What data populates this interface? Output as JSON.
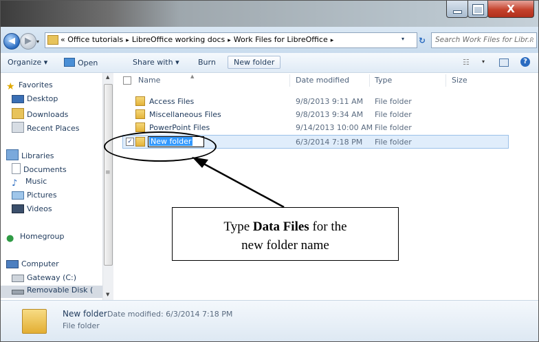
{
  "window": {
    "controls": {
      "minimize": "minimize",
      "maximize": "maximize",
      "close_glyph": "X"
    }
  },
  "address": {
    "history_glyph": "▾",
    "overflow": "«",
    "crumbs": [
      "Office tutorials",
      "LibreOffice working docs",
      "Work Files for LibreOffice"
    ],
    "crumb_sep": "▸",
    "refresh": "↻"
  },
  "search": {
    "placeholder": "Search Work Files for Libr..."
  },
  "toolbar": {
    "organize": "Organize ▾",
    "open": "Open",
    "share_with": "Share with ▾",
    "burn": "Burn",
    "new_folder": "New folder",
    "help": "?"
  },
  "nav": {
    "favorites": "Favorites",
    "desktop": "Desktop",
    "downloads": "Downloads",
    "recent_places": "Recent Places",
    "libraries": "Libraries",
    "documents": "Documents",
    "music": "Music",
    "pictures": "Pictures",
    "videos": "Videos",
    "homegroup": "Homegroup",
    "computer": "Computer",
    "gateway": "Gateway (C:)",
    "removable": "Removable Disk ("
  },
  "columns": {
    "name": "Name",
    "date": "Date modified",
    "type": "Type",
    "size": "Size"
  },
  "files": [
    {
      "name": "Access Files",
      "date": "9/8/2013 9:11 AM",
      "type": "File folder"
    },
    {
      "name": "Miscellaneous Files",
      "date": "9/8/2013 9:34 AM",
      "type": "File folder"
    },
    {
      "name": "PowerPoint Files",
      "date": "9/14/2013 10:00 AM",
      "type": "File folder"
    }
  ],
  "editing_row": {
    "name": "New folder",
    "date": "6/3/2014 7:18 PM",
    "type": "File folder",
    "check": "✓"
  },
  "callout": {
    "line1_pre": "Type ",
    "line1_bold": "Data Files",
    "line1_post": " for the",
    "line2": "new folder name"
  },
  "details": {
    "name": "New folder",
    "modified": "Date modified: 6/3/2014 7:18 PM",
    "type": "File folder"
  },
  "colors": {
    "accent": "#2a6bc0",
    "selection": "#3399ff",
    "close_red": "#c5422c"
  }
}
